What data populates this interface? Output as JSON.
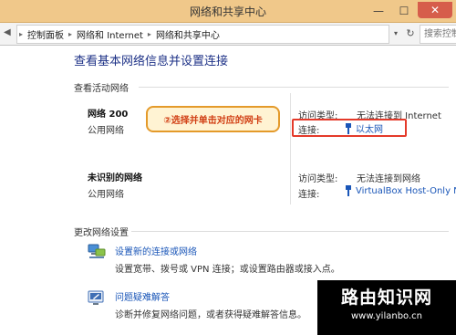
{
  "window": {
    "title": "网络和共享中心",
    "controls": {
      "minimize": "—",
      "maximize": "☐",
      "close": "✕"
    }
  },
  "address": {
    "nav_icon": "chevron-left-icon",
    "breadcrumbs": [
      "控制面板",
      "网络和 Internet",
      "网络和共享中心"
    ],
    "separator": "▸",
    "dropdown": "▾",
    "refresh": "↻",
    "search_placeholder": "搜索控制面"
  },
  "main": {
    "heading": "查看基本网络信息并设置连接",
    "active_label": "查看活动网络",
    "networks": [
      {
        "name": "网络 200",
        "type": "公用网络",
        "access_key": "访问类型:",
        "access_value": "无法连接到 Internet",
        "connection_key": "连接:",
        "connection_value": "以太网"
      },
      {
        "name": "未识别的网络",
        "type": "公用网络",
        "access_key": "访问类型:",
        "access_value": "无法连接到网络",
        "connection_key": "连接:",
        "connection_value": "VirtualBox Host-Only N"
      }
    ],
    "callout": "②选择并单击对应的网卡",
    "change_label": "更改网络设置",
    "tasks": [
      {
        "link": "设置新的连接或网络",
        "desc": "设置宽带、拨号或 VPN 连接；或设置路由器或接入点。",
        "icon": "network-setup-icon"
      },
      {
        "link": "问题疑难解答",
        "desc": "诊断并修复网络问题，或者获得疑难解答信息。",
        "icon": "troubleshoot-icon"
      }
    ]
  },
  "watermark": {
    "title": "路由知识网",
    "url": "www.yilanbo.cn"
  },
  "colors": {
    "titlebar": "#f0c88a",
    "heading": "#1e3287",
    "link": "#1a56b8",
    "callout_border": "#e49a2a",
    "callout_text": "#d13f14",
    "highlight": "#e43a2a"
  }
}
